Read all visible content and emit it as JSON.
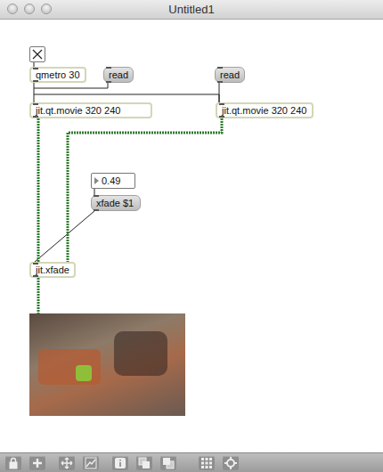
{
  "window": {
    "title": "Untitled1"
  },
  "boxes": [
    {
      "kind": "toggle",
      "text": "",
      "checked": true
    },
    {
      "kind": "object",
      "text": "qmetro 30"
    },
    {
      "kind": "message",
      "text": "read"
    },
    {
      "kind": "message",
      "text": "read"
    },
    {
      "kind": "object",
      "text": "jit.qt.movie 320 240"
    },
    {
      "kind": "object",
      "text": "jit.qt.movie 320 240"
    },
    {
      "kind": "number",
      "text": "0.49"
    },
    {
      "kind": "message",
      "text": "xfade $1"
    },
    {
      "kind": "object",
      "text": "jit.xfade"
    }
  ],
  "display": {
    "kind": "video"
  }
}
